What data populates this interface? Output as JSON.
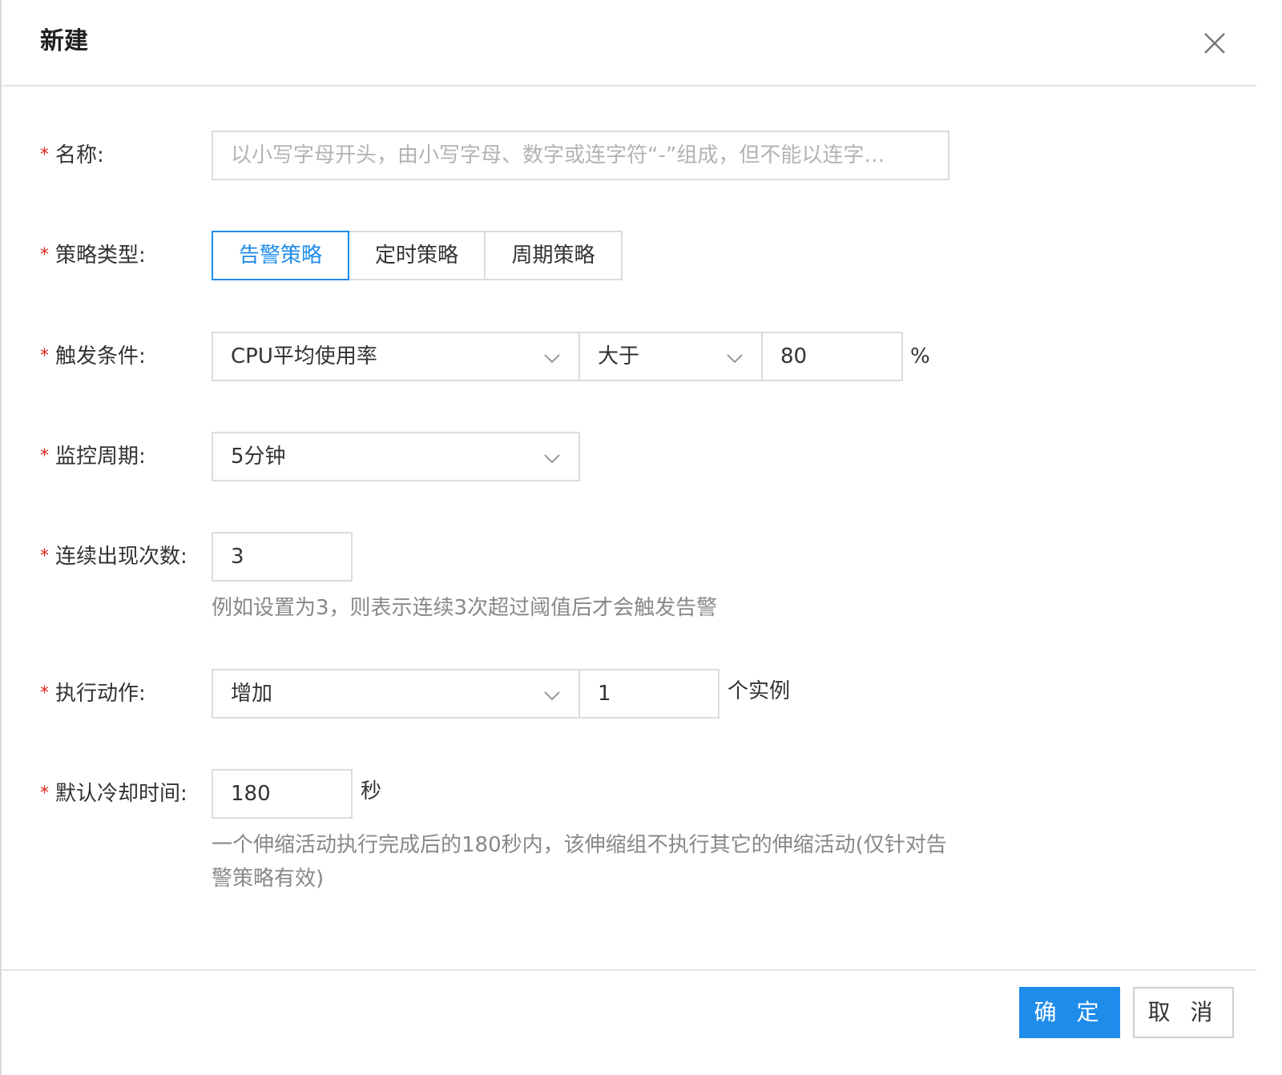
{
  "dialog": {
    "title": "新建",
    "confirm_label": "确 定",
    "cancel_label": "取 消"
  },
  "form": {
    "name": {
      "label": "名称:",
      "placeholder": "以小写字母开头，由小写字母、数字或连字符“-”组成，但不能以连字…"
    },
    "policy_type": {
      "label": "策略类型:",
      "options": [
        "告警策略",
        "定时策略",
        "周期策略"
      ],
      "selected": "告警策略"
    },
    "trigger": {
      "label": "触发条件:",
      "metric": "CPU平均使用率",
      "comparator": "大于",
      "threshold": "80",
      "unit": "%"
    },
    "monitor_period": {
      "label": "监控周期:",
      "value": "5分钟"
    },
    "consecutive": {
      "label": "连续出现次数:",
      "value": "3",
      "hint": "例如设置为3，则表示连续3次超过阈值后才会触发告警"
    },
    "action": {
      "label": "执行动作:",
      "type": "增加",
      "count": "1",
      "unit": "个实例"
    },
    "cooldown": {
      "label": "默认冷却时间:",
      "value": "180",
      "unit": "秒",
      "hint": "一个伸缩活动执行完成后的180秒内，该伸缩组不执行其它的伸缩活动(仅针对告警策略有效)"
    }
  },
  "colors": {
    "accent": "#1e8ceb",
    "required": "#e1251b",
    "border": "#dcdcdc",
    "hint": "#888888"
  }
}
